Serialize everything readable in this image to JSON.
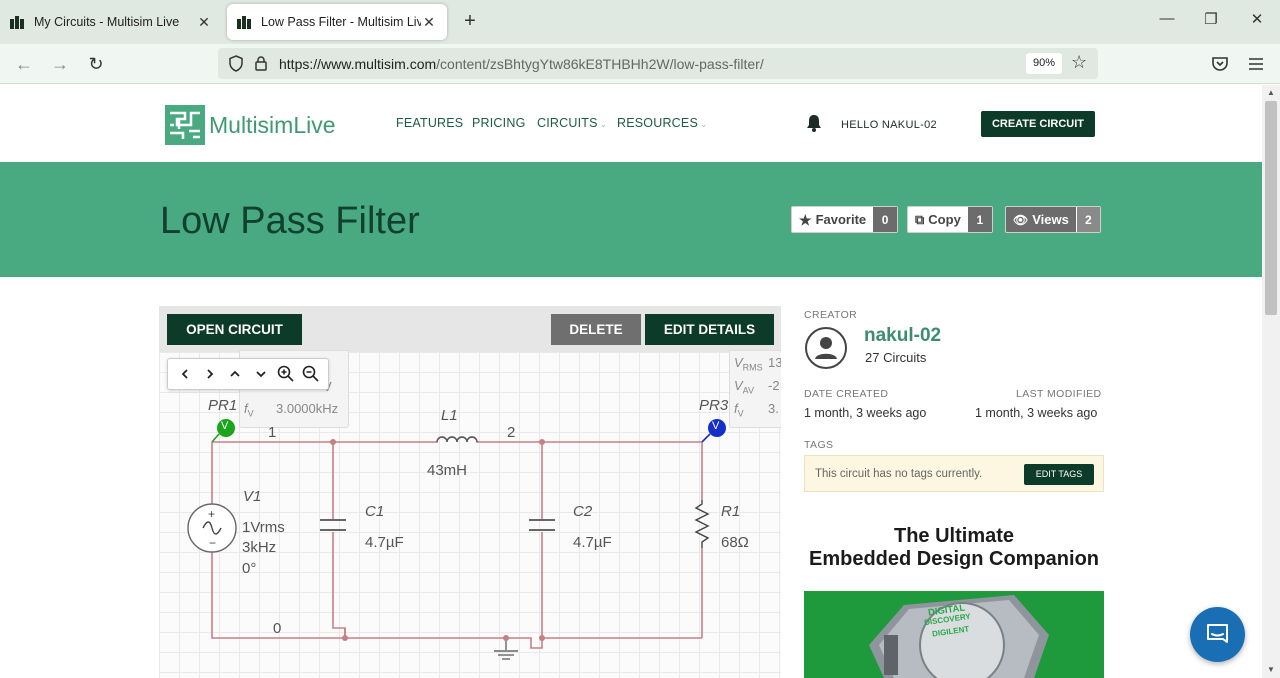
{
  "browser": {
    "tabs": [
      {
        "title": "My Circuits - Multisim Live",
        "active": false
      },
      {
        "title": "Low Pass Filter - Multisim Live",
        "active": true
      }
    ],
    "url_host": "https://www.multisim.com",
    "url_path": "/content/zsBhtygYtw86kE8THBHh2W/low-pass-filter/",
    "zoom": "90%"
  },
  "site": {
    "brand": "MultisimLive",
    "nav": [
      "FEATURES",
      "PRICING",
      "CIRCUITS",
      "RESOURCES"
    ],
    "hello": "HELLO  NAKUL-02",
    "create_button": "CREATE CIRCUIT"
  },
  "banner": {
    "title": "Low Pass Filter",
    "favorite": {
      "label": "Favorite",
      "count": "0"
    },
    "copy": {
      "label": "Copy",
      "count": "1"
    },
    "views": {
      "label": "Views",
      "count": "2"
    }
  },
  "panel": {
    "open_button": "OPEN CIRCUIT",
    "delete_button": "DELETE",
    "edit_button": "EDIT DETAILS"
  },
  "schematic": {
    "probe_left": {
      "name": "PR1",
      "tag": "V",
      "freq_sym": "f",
      "freq_sub": "V",
      "freq_value": "3.0000kHz",
      "partial_value": "V"
    },
    "probe_right": {
      "name": "PR3",
      "tag": "V",
      "rms_sym": "V",
      "rms_sub": "RMS",
      "rms_value": "13",
      "av_sym": "V",
      "av_sub": "AV",
      "av_value": "-2",
      "freq_sym": "f",
      "freq_sub": "V",
      "freq_value": "3."
    },
    "nodes": {
      "n1": "1",
      "n2": "2",
      "n0": "0"
    },
    "v1": {
      "name": "V1",
      "value": "1Vrms",
      "freq": "3kHz",
      "phase": "0°"
    },
    "c1": {
      "name": "C1",
      "value": "4.7µF"
    },
    "c2": {
      "name": "C2",
      "value": "4.7µF"
    },
    "l1": {
      "name": "L1",
      "value": "43mH"
    },
    "r1": {
      "name": "R1",
      "value": "68Ω"
    }
  },
  "sidebar": {
    "creator_label": "CREATOR",
    "creator_name": "nakul-02",
    "creator_circuits": "27 Circuits",
    "date_created_label": "DATE CREATED",
    "date_created": "1 month, 3 weeks ago",
    "last_modified_label": "LAST MODIFIED",
    "last_modified": "1 month, 3 weeks ago",
    "tags_label": "TAGS",
    "tags_empty": "This circuit has no tags currently.",
    "edit_tags": "EDIT TAGS"
  },
  "ad": {
    "line1": "The Ultimate",
    "line2": "Embedded Design Companion",
    "device_text1": "DIGITAL",
    "device_text2": "DISCOVERY",
    "device_brand": "DIGILENT"
  },
  "colors": {
    "brand_green": "#49aa81",
    "dark_green": "#0d3b29",
    "wire": "#c77f86"
  }
}
